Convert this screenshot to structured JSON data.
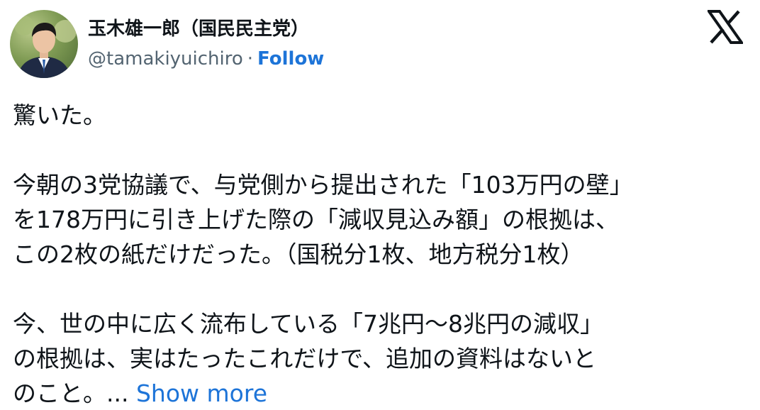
{
  "author": {
    "name": "玉木雄一郎（国民民主党）",
    "handle": "@tamakiyuichiro",
    "separator": "·",
    "follow_label": "Follow"
  },
  "platform_icon": "x-logo-icon",
  "colors": {
    "link": "#1d74d8",
    "text": "#0f1419",
    "muted": "#536471"
  },
  "tweet": {
    "p1": "驚いた。",
    "p2_line1": "今朝の3党協議で、与党側から提出された「103万円の壁」",
    "p2_line2": "を178万円に引き上げた際の「減収見込み額」の根拠は、",
    "p2_line3": "この2枚の紙だけだった。（国税分1枚、地方税分1枚）",
    "p3_line1": "今、世の中に広く流布している「7兆円〜8兆円の減収」",
    "p3_line2": "の根拠は、実はたったこれだけで、追加の資料はないと",
    "p3_line3": "のこと。...",
    "show_more_label": "Show more"
  }
}
